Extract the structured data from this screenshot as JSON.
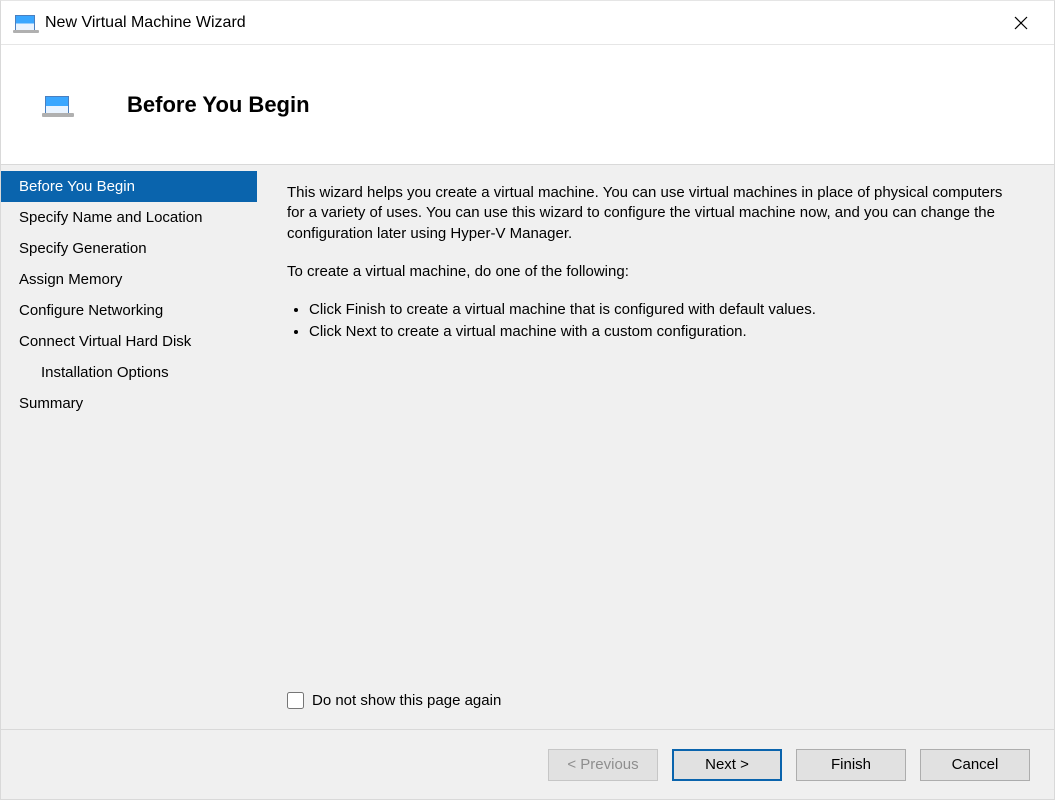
{
  "window": {
    "title": "New Virtual Machine Wizard"
  },
  "header": {
    "headline": "Before You Begin"
  },
  "sidebar": {
    "steps": [
      {
        "label": "Before You Begin",
        "active": true,
        "indent": false
      },
      {
        "label": "Specify Name and Location",
        "active": false,
        "indent": false
      },
      {
        "label": "Specify Generation",
        "active": false,
        "indent": false
      },
      {
        "label": "Assign Memory",
        "active": false,
        "indent": false
      },
      {
        "label": "Configure Networking",
        "active": false,
        "indent": false
      },
      {
        "label": "Connect Virtual Hard Disk",
        "active": false,
        "indent": false
      },
      {
        "label": "Installation Options",
        "active": false,
        "indent": true
      },
      {
        "label": "Summary",
        "active": false,
        "indent": false
      }
    ]
  },
  "content": {
    "paragraph1": "This wizard helps you create a virtual machine. You can use virtual machines in place of physical computers for a variety of uses. You can use this wizard to configure the virtual machine now, and you can change the configuration later using Hyper-V Manager.",
    "paragraph2": "To create a virtual machine, do one of the following:",
    "bullets": [
      "Click Finish to create a virtual machine that is configured with default values.",
      "Click Next to create a virtual machine with a custom configuration."
    ],
    "checkbox_label": "Do not show this page again"
  },
  "footer": {
    "previous": "< Previous",
    "next": "Next >",
    "finish": "Finish",
    "cancel": "Cancel"
  }
}
